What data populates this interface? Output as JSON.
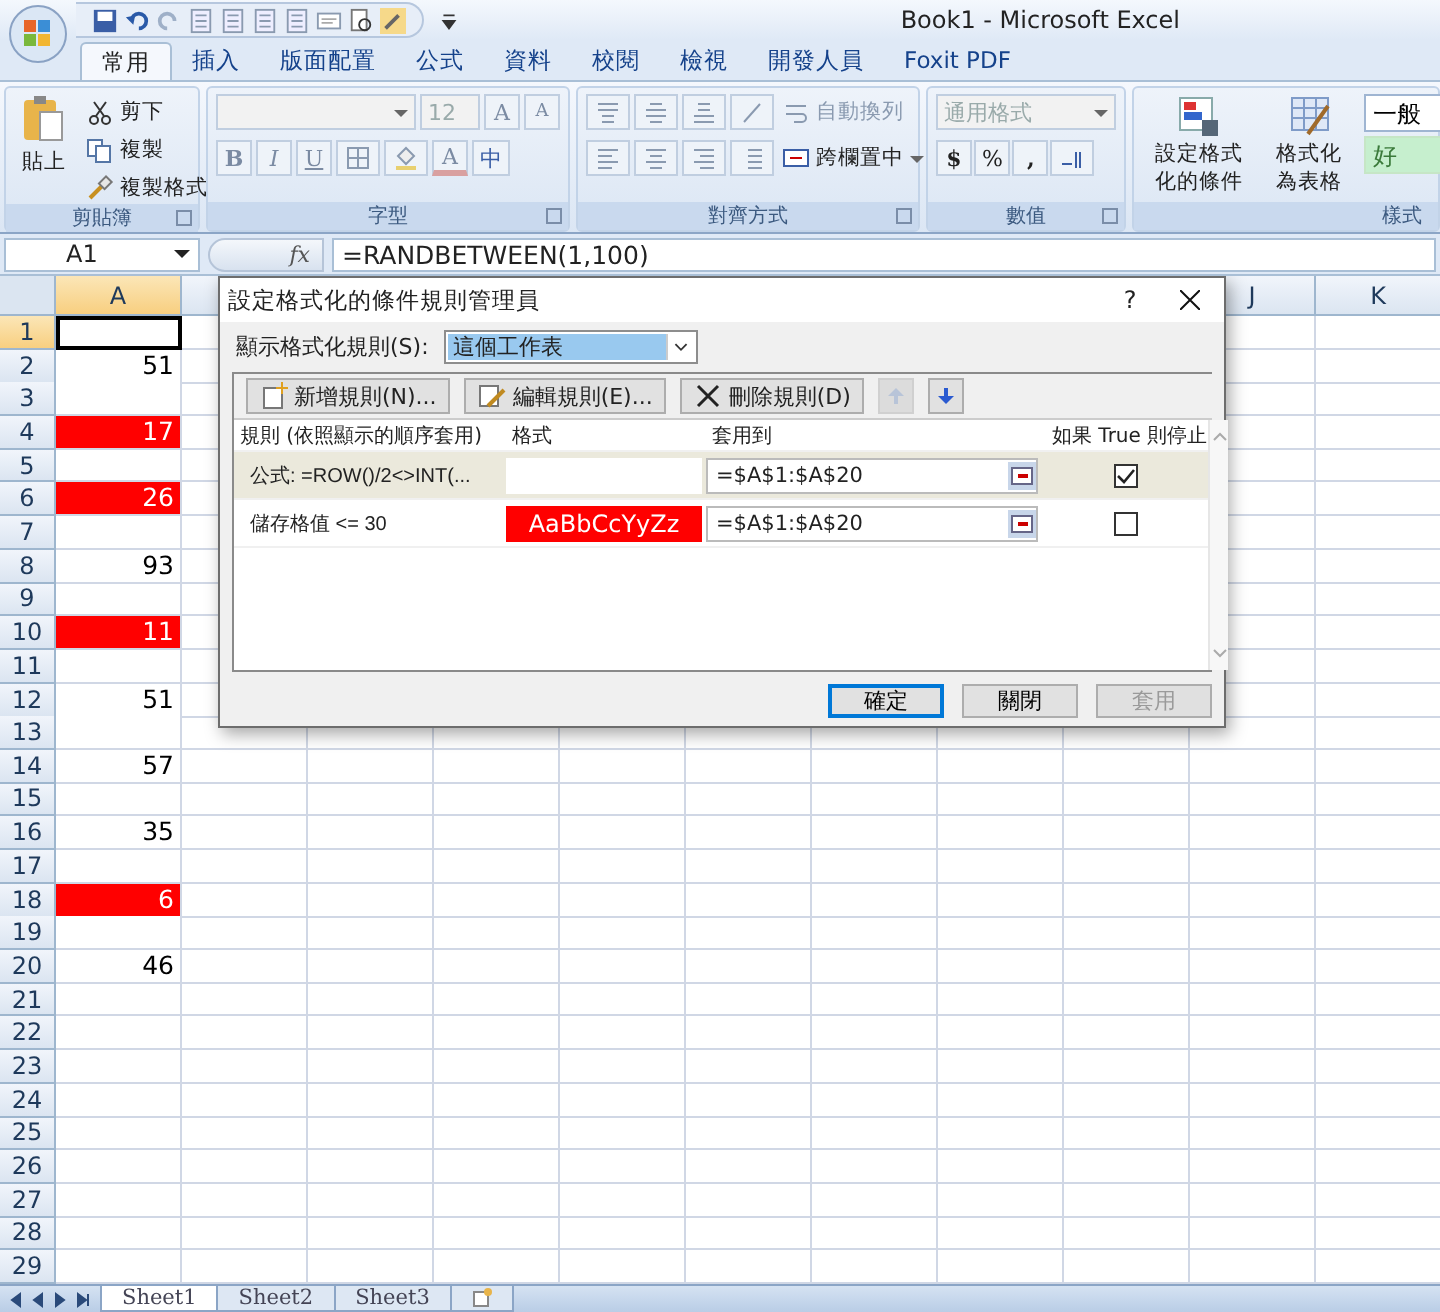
{
  "window": {
    "title": "Book1 - Microsoft Excel"
  },
  "ribbon_tabs": [
    {
      "label": "常用",
      "selected": true
    },
    {
      "label": "插入",
      "selected": false
    },
    {
      "label": "版面配置",
      "selected": false
    },
    {
      "label": "公式",
      "selected": false
    },
    {
      "label": "資料",
      "selected": false
    },
    {
      "label": "校閱",
      "selected": false
    },
    {
      "label": "檢視",
      "selected": false
    },
    {
      "label": "開發人員",
      "selected": false
    },
    {
      "label": "Foxit PDF",
      "selected": false
    }
  ],
  "ribbon": {
    "clipboard": {
      "title": "剪貼簿",
      "paste": "貼上",
      "items": [
        "剪下",
        "複製",
        "複製格式"
      ]
    },
    "font": {
      "title": "字型",
      "size": "12",
      "grow": "A",
      "shrink": "A",
      "bold": "B",
      "italic": "I",
      "underline": "U",
      "font_color_label": "A",
      "phonetic": "中"
    },
    "alignment": {
      "title": "對齊方式",
      "wrap": "自動換列",
      "merge": "跨欄置中"
    },
    "number": {
      "title": "數值",
      "format": "通用格式",
      "currency": "$",
      "percent": "%",
      "comma": ","
    },
    "styles": {
      "title": "樣式",
      "conditional": "設定格式化的條件",
      "table": "格式化為表格",
      "cell_styles": [
        "一般",
        "好"
      ]
    }
  },
  "formula_bar": {
    "name_box": "A1",
    "fx": "fx",
    "formula": "=RANDBETWEEN(1,100)"
  },
  "sheet": {
    "column_headers": {
      "left": [
        "A"
      ],
      "right": [
        "J",
        "K"
      ]
    },
    "rows": [
      {
        "number": "1",
        "selected": true,
        "highlighted": false
      },
      {
        "number": "2",
        "value": "51",
        "selected": false,
        "highlighted": false
      },
      {
        "number": "3",
        "selected": false,
        "highlighted": false
      },
      {
        "number": "4",
        "value": "17",
        "selected": false,
        "highlighted": true
      },
      {
        "number": "5",
        "selected": false,
        "highlighted": false
      },
      {
        "number": "6",
        "value": "26",
        "selected": false,
        "highlighted": true
      },
      {
        "number": "7",
        "selected": false,
        "highlighted": false
      },
      {
        "number": "8",
        "value": "93",
        "selected": false,
        "highlighted": false
      },
      {
        "number": "9",
        "selected": false,
        "highlighted": false
      },
      {
        "number": "10",
        "value": "11",
        "selected": false,
        "highlighted": true
      },
      {
        "number": "11",
        "selected": false,
        "highlighted": false
      },
      {
        "number": "12",
        "value": "51",
        "selected": false,
        "highlighted": false
      },
      {
        "number": "13",
        "selected": false,
        "highlighted": false
      },
      {
        "number": "14",
        "value": "57",
        "selected": false,
        "highlighted": false
      },
      {
        "number": "15",
        "selected": false,
        "highlighted": false
      },
      {
        "number": "16",
        "value": "35",
        "selected": false,
        "highlighted": false
      },
      {
        "number": "17",
        "selected": false,
        "highlighted": false
      },
      {
        "number": "18",
        "value": "6",
        "selected": false,
        "highlighted": true
      },
      {
        "number": "19",
        "selected": false,
        "highlighted": false
      },
      {
        "number": "20",
        "value": "46",
        "selected": false,
        "highlighted": false
      },
      {
        "number": "21",
        "selected": false,
        "highlighted": false
      },
      {
        "number": "22",
        "selected": false,
        "highlighted": false
      },
      {
        "number": "23",
        "selected": false,
        "highlighted": false
      },
      {
        "number": "24",
        "selected": false,
        "highlighted": false
      },
      {
        "number": "25",
        "selected": false,
        "highlighted": false
      },
      {
        "number": "26",
        "selected": false,
        "highlighted": false
      },
      {
        "number": "27",
        "selected": false,
        "highlighted": false
      },
      {
        "number": "28",
        "selected": false,
        "highlighted": false
      },
      {
        "number": "29",
        "selected": false,
        "highlighted": false
      }
    ]
  },
  "dialog": {
    "title": "設定格式化的條件規則管理員",
    "help": "?",
    "show_label": "顯示格式化規則(S):",
    "show_value": "這個工作表",
    "buttons": [
      "新增規則(N)...",
      "編輯規則(E)...",
      "刪除規則(D)"
    ],
    "move_buttons": [
      {
        "disabled": true
      },
      {
        "disabled": false
      }
    ],
    "columns": [
      "規則 (依照顯示的順序套用)",
      "格式",
      "套用到",
      "如果 True 則停止"
    ],
    "rules": [
      {
        "rule": "公式: =ROW()/2<>INT(...",
        "preview_filled": false,
        "applies_to": "=$A$1:$A$20",
        "stop_if_true": true,
        "selected": true
      },
      {
        "rule": "儲存格值 <= 30",
        "preview": "AaBbCcYyZz",
        "preview_filled": true,
        "applies_to": "=$A$1:$A$20",
        "stop_if_true": false,
        "selected": false
      }
    ],
    "footer_buttons": [
      {
        "label": "確定",
        "default": true,
        "disabled": false
      },
      {
        "label": "關閉",
        "default": false,
        "disabled": false
      },
      {
        "label": "套用",
        "default": false,
        "disabled": true
      }
    ]
  },
  "sheet_tabs": [
    {
      "label": "Sheet1",
      "selected": true
    },
    {
      "label": "Sheet2",
      "selected": false
    },
    {
      "label": "Sheet3",
      "selected": false
    }
  ]
}
